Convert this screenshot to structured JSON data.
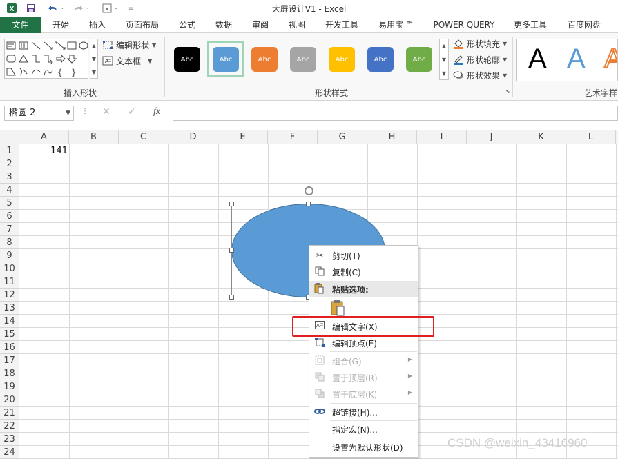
{
  "title_bar": {
    "title": "大屏设计V1 - Excel"
  },
  "tabs": [
    "文件",
    "开始",
    "插入",
    "页面布局",
    "公式",
    "数据",
    "审阅",
    "视图",
    "开发工具",
    "易用宝 ™",
    "POWER QUERY",
    "更多工具",
    "百度网盘"
  ],
  "ribbon": {
    "insert_shapes": {
      "label": "插入形状",
      "edit_shape": "编辑形状",
      "text_box": "文本框"
    },
    "shape_styles": {
      "label": "形状样式",
      "swatch_text": "Abc",
      "swatch_colors": [
        "#000000",
        "#5b9bd5",
        "#ed7d31",
        "#a5a5a5",
        "#ffc000",
        "#4472c4",
        "#70ad47"
      ],
      "fill": "形状填充",
      "outline": "形状轮廓",
      "effects": "形状效果"
    },
    "wordart": {
      "label": "艺术字样",
      "letter": "A"
    }
  },
  "formula_bar": {
    "name_box": "椭圆 2",
    "fx": "fx"
  },
  "sheet": {
    "columns": [
      "A",
      "B",
      "C",
      "D",
      "E",
      "F",
      "G",
      "H",
      "I",
      "J",
      "K",
      "L"
    ],
    "rows": [
      "1",
      "2",
      "3",
      "4",
      "5",
      "6",
      "7",
      "8",
      "9",
      "10",
      "11",
      "12",
      "13",
      "14",
      "15",
      "16",
      "17",
      "18",
      "19",
      "20",
      "21",
      "22",
      "23",
      "24"
    ],
    "cell_a1": "141"
  },
  "context_menu": {
    "cut": "剪切(T)",
    "copy": "复制(C)",
    "paste_options": "粘贴选项:",
    "edit_text": "编辑文字(X)",
    "edit_points": "编辑顶点(E)",
    "group": "组合(G)",
    "bring_to_front": "置于顶层(R)",
    "send_to_back": "置于底层(K)",
    "hyperlink": "超链接(H)...",
    "assign_macro": "指定宏(N)...",
    "set_default_shape": "设置为默认形状(D)"
  },
  "watermark": "CSDN @weixin_43416960",
  "colors": {
    "accent": "#217346",
    "shape_fill": "#5b9bd5",
    "highlight": "#e02020"
  }
}
